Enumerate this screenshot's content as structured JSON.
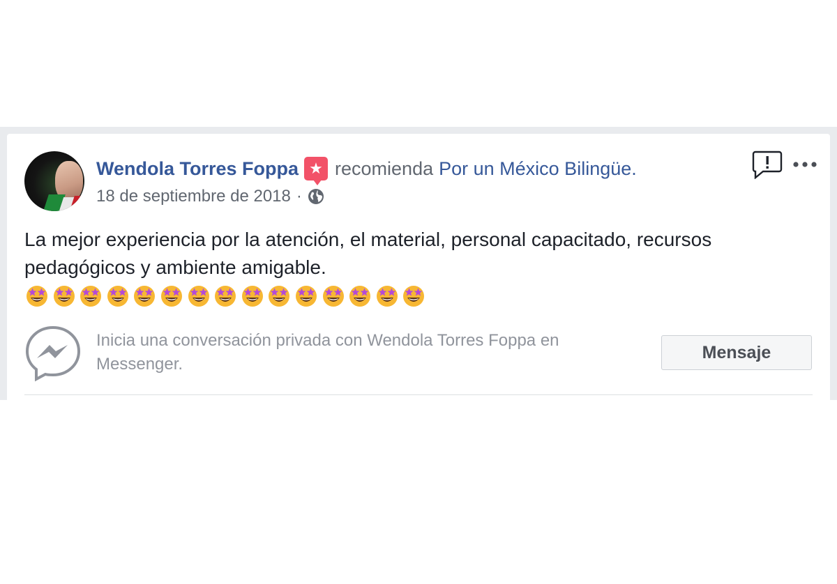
{
  "post": {
    "author": "Wendola Torres Foppa",
    "action": "recomienda",
    "page": "Por un México Bilingüe.",
    "date": "18 de septiembre de 2018",
    "separator": "·",
    "privacy_icon": "globe-icon",
    "badge_icon": "star-icon",
    "body": "La mejor experiencia por la atención, el material, personal capacitado, recursos pedagógicos y ambiente amigable.",
    "emoji": "star-struck-emoji",
    "emoji_count": 15,
    "report_icon": "report-icon",
    "more_icon": "more-options-icon"
  },
  "messenger": {
    "prompt": "Inicia una conversación privada con Wendola Torres Foppa en Messenger.",
    "button_label": "Mensaje",
    "icon": "messenger-icon"
  },
  "colors": {
    "link": "#365899",
    "badge": "#f25268",
    "secondary_text": "#616770",
    "muted_text": "#90949c",
    "frame": "#e9ebee"
  }
}
